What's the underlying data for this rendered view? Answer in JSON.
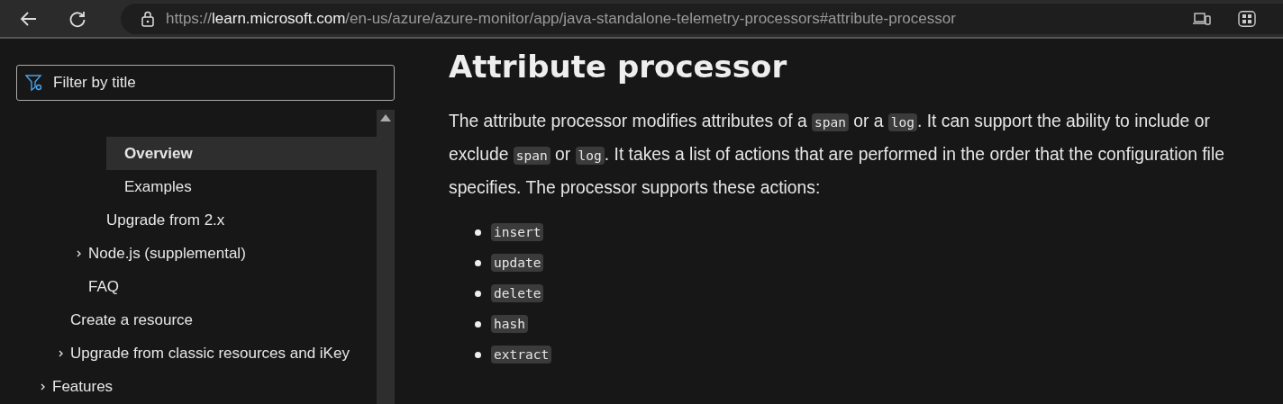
{
  "browser": {
    "url": {
      "scheme": "https://",
      "host": "learn.microsoft.com",
      "path": "/en-us/azure/azure-monitor/app/java-standalone-telemetry-processors#attribute-processor"
    }
  },
  "sidebar": {
    "filter": {
      "placeholder": "Filter by title"
    },
    "tree": [
      {
        "children": [
          {
            "children": [
              {
                "children": [
                  {
                    "children": [
                      {
                        "label": "Overview",
                        "selected": true
                      },
                      {
                        "label": "Examples",
                        "selected": false
                      }
                    ]
                  },
                  {
                    "label": "Upgrade from 2.x",
                    "selected": false
                  }
                ]
              },
              {
                "label": "Node.js (supplemental)",
                "selected": false,
                "expanded": false
              },
              {
                "label": "FAQ",
                "selected": false
              }
            ]
          },
          {
            "label": "Create a resource",
            "selected": false
          },
          {
            "label": "Upgrade from classic resources and iKey",
            "selected": false,
            "expanded": false
          }
        ]
      },
      {
        "label": "Features",
        "selected": false,
        "expanded": false
      }
    ]
  },
  "article": {
    "heading": "Attribute processor",
    "paragraph": [
      {
        "kind": "text",
        "text": "The attribute processor modifies attributes of a "
      },
      {
        "kind": "code",
        "text": "span"
      },
      {
        "kind": "text",
        "text": " or a "
      },
      {
        "kind": "code",
        "text": "log"
      },
      {
        "kind": "text",
        "text": ". It can support the ability to include or exclude "
      },
      {
        "kind": "code",
        "text": "span"
      },
      {
        "kind": "text",
        "text": " or "
      },
      {
        "kind": "code",
        "text": "log"
      },
      {
        "kind": "text",
        "text": ". It takes a list of actions that are performed in the order that the configuration file specifies. The processor supports these actions:"
      }
    ],
    "actions": [
      "insert",
      "update",
      "delete",
      "hash",
      "extract"
    ]
  }
}
